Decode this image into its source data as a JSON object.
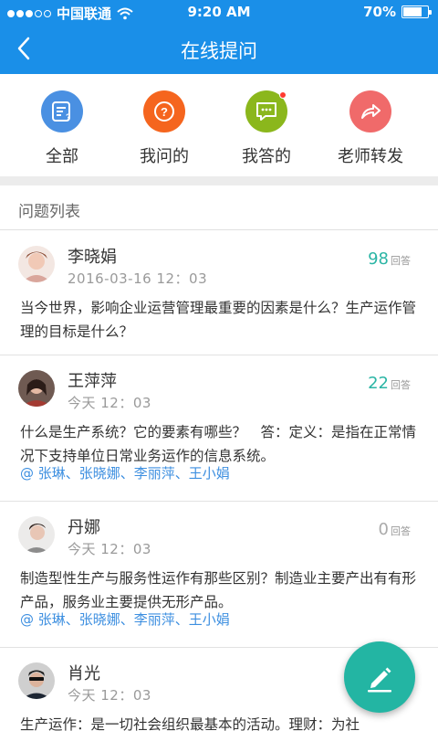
{
  "status": {
    "carrier": "中国联通",
    "time": "9:20 AM",
    "battery": "70%"
  },
  "nav": {
    "title": "在线提问"
  },
  "tabs": [
    {
      "label": "全部",
      "color": "#4a90e2",
      "icon": "list-icon"
    },
    {
      "label": "我问的",
      "color": "#f5651e",
      "icon": "question-icon"
    },
    {
      "label": "我答的",
      "color": "#8bb71c",
      "icon": "chat-icon"
    },
    {
      "label": "老师转发",
      "color": "#f06a6a",
      "icon": "share-icon"
    }
  ],
  "section": {
    "title": "问题列表"
  },
  "questions": [
    {
      "name": "李晓娟",
      "time": "2016-03-16 12：03",
      "count": "98",
      "count_suffix": "回答",
      "text": "当今世界，影响企业运营管理最重要的因素是什么？生产运作管理的目标是什么？",
      "mentions": ""
    },
    {
      "name": "王萍萍",
      "time": "今天 12：03",
      "count": "22",
      "count_suffix": "回答",
      "text": "什么是生产系统？它的要素有哪些？　答：定义：是指在正常情况下支持单位日常业务运作的信息系统。",
      "mentions": "@ 张琳、张晓娜、李丽萍、王小娟"
    },
    {
      "name": "丹娜",
      "time": "今天 12：03",
      "count": "0",
      "count_suffix": "回答",
      "text": "制造型性生产与服务性运作有那些区别？制造业主要产出有有形产品，服务业主要提供无形产品。",
      "mentions": "@ 张琳、张晓娜、李丽萍、王小娟"
    },
    {
      "name": "肖光",
      "time": "今天 12：03",
      "count": "",
      "count_suffix": "",
      "text": "生产运作：是一切社会组织最基本的活动。理财：为社",
      "mentions": ""
    }
  ]
}
